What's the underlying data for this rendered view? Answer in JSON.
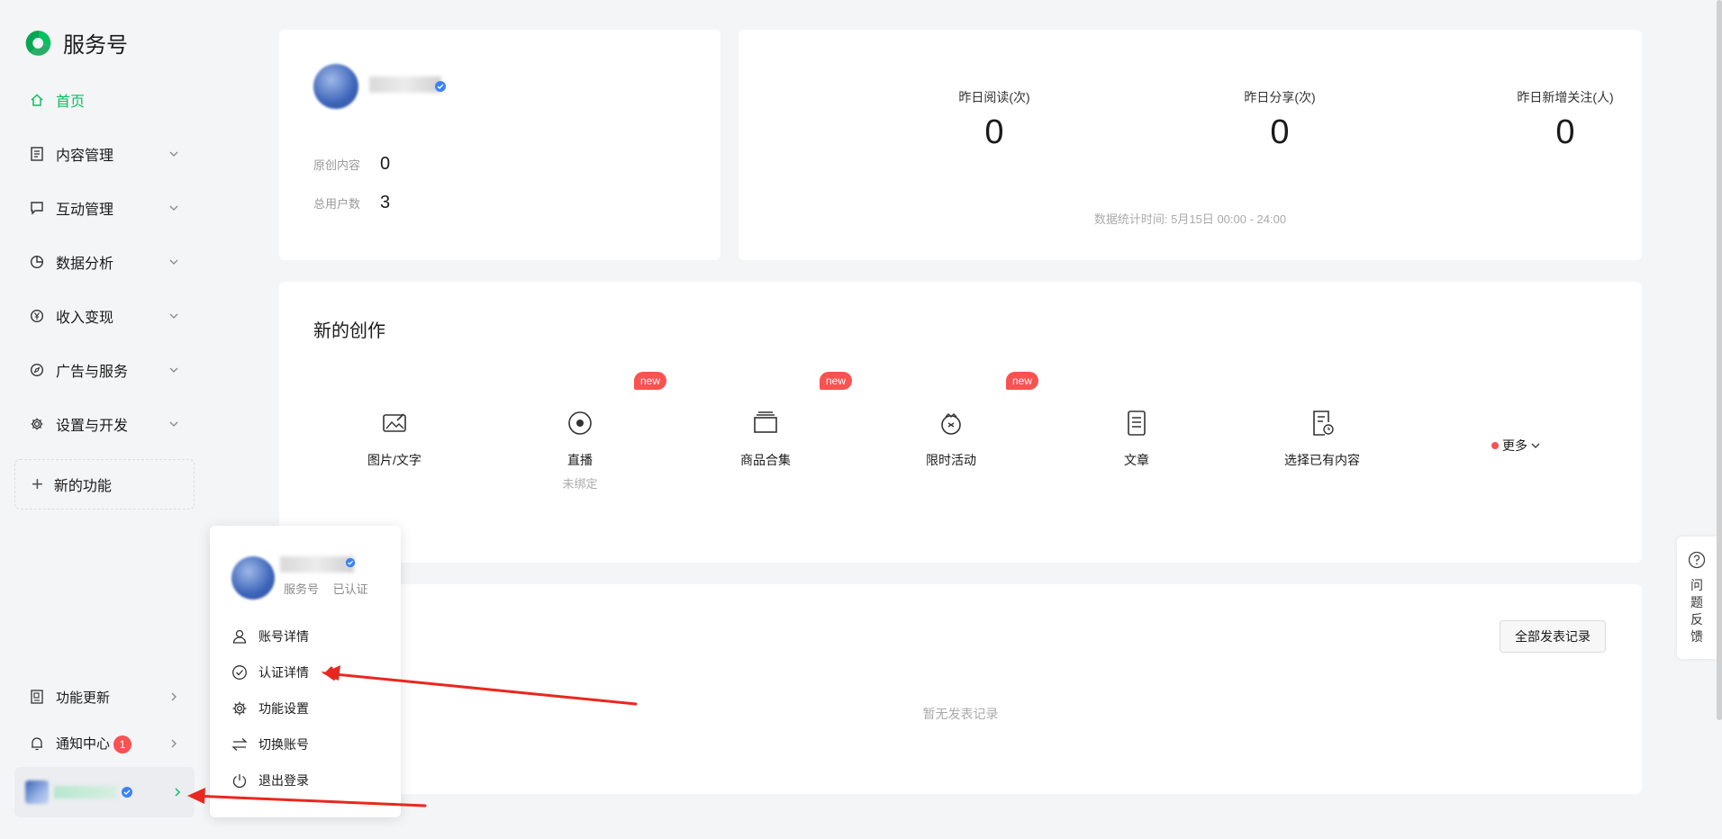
{
  "app": {
    "logo_text": "服务号",
    "brand_color": "#07c160",
    "alert_color": "#fa5151"
  },
  "sidebar": {
    "items": [
      {
        "label": "首页",
        "icon": "home-icon",
        "active": true
      },
      {
        "label": "内容管理",
        "icon": "document-icon"
      },
      {
        "label": "互动管理",
        "icon": "chat-icon"
      },
      {
        "label": "数据分析",
        "icon": "pie-chart-icon"
      },
      {
        "label": "收入变现",
        "icon": "yen-icon"
      },
      {
        "label": "广告与服务",
        "icon": "compass-icon"
      },
      {
        "label": "设置与开发",
        "icon": "gear-icon"
      }
    ],
    "new_func": "新的功能",
    "func_update": "功能更新",
    "notify": "通知中心",
    "notify_count": "1"
  },
  "profile": {
    "original_label": "原创内容",
    "original_value": "0",
    "users_label": "总用户数",
    "users_value": "3"
  },
  "stats": {
    "reads_label": "昨日阅读(次)",
    "reads_value": "0",
    "shares_label": "昨日分享(次)",
    "shares_value": "0",
    "follows_label": "昨日新增关注(人)",
    "follows_value": "0",
    "time_note": "数据统计时间: 5月15日 00:00 - 24:00"
  },
  "create": {
    "title": "新的创作",
    "new_tag": "new",
    "tools": [
      {
        "label": "图片/文字",
        "icon": "image-text-icon"
      },
      {
        "label": "直播",
        "sub": "未绑定",
        "icon": "live-icon"
      },
      {
        "label": "商品合集",
        "icon": "product-collection-icon"
      },
      {
        "label": "限时活动",
        "icon": "limited-activity-icon"
      },
      {
        "label": "文章",
        "icon": "article-icon"
      },
      {
        "label": "选择已有内容",
        "icon": "existing-content-icon"
      }
    ],
    "more": "更多"
  },
  "publish": {
    "all_records": "全部发表记录",
    "empty": "暂无发表记录"
  },
  "feedback": {
    "label": "问题反馈"
  },
  "popover": {
    "sub_type": "服务号",
    "sub_status": "已认证",
    "items": [
      {
        "label": "账号详情",
        "icon": "user-icon"
      },
      {
        "label": "认证详情",
        "icon": "check-circle-icon"
      },
      {
        "label": "功能设置",
        "icon": "gear-icon"
      },
      {
        "label": "切换账号",
        "icon": "switch-icon"
      },
      {
        "label": "退出登录",
        "icon": "power-icon"
      }
    ]
  }
}
